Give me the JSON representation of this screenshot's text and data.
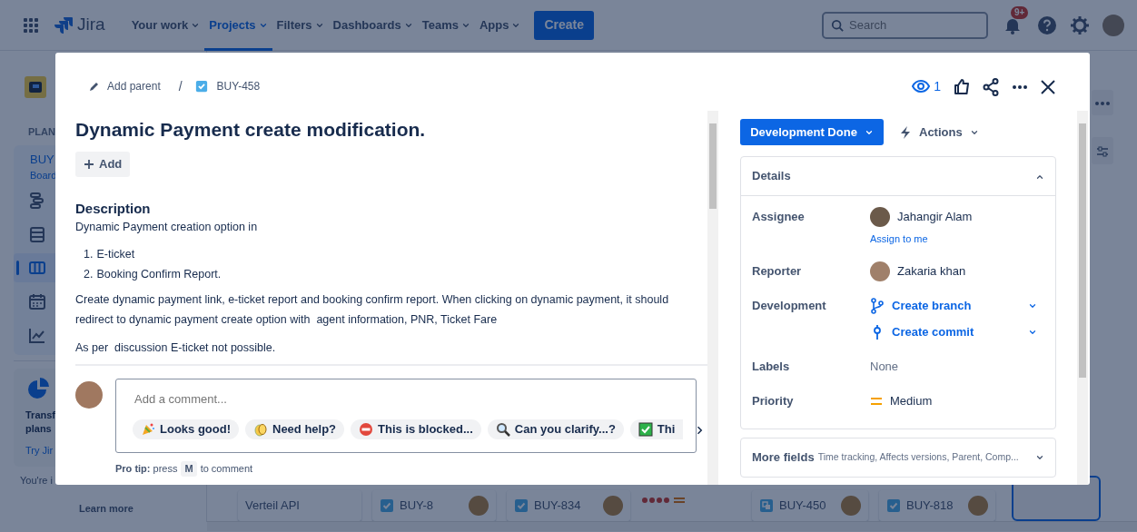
{
  "top_nav": {
    "product": "Jira",
    "menus": [
      {
        "label": "Your work",
        "selected": false
      },
      {
        "label": "Projects",
        "selected": true
      },
      {
        "label": "Filters",
        "selected": false
      },
      {
        "label": "Dashboards",
        "selected": false
      },
      {
        "label": "Teams",
        "selected": false
      },
      {
        "label": "Apps",
        "selected": false
      }
    ],
    "create_button": "Create",
    "search": {
      "placeholder": "Search"
    },
    "notification_count": "9+"
  },
  "sidebar": {
    "section_heading": "PLAN",
    "project_name": "BUY",
    "project_view": "Board",
    "items": [
      {
        "selected": false
      },
      {
        "selected": false
      },
      {
        "selected": true
      },
      {
        "selected": false
      },
      {
        "selected": false
      }
    ],
    "promo": {
      "title_lines": [
        "Transf",
        "plans"
      ],
      "link": "Try Jir"
    },
    "footer_text": "You're i",
    "learn_more": "Learn more"
  },
  "board": {
    "cards": [
      {
        "kind": "title",
        "text": "Verteil API"
      },
      {
        "kind": "task",
        "key": "BUY-8"
      },
      {
        "kind": "task",
        "key": "BUY-834"
      },
      {
        "kind": "estimate"
      },
      {
        "kind": "subtask",
        "key": "BUY-450"
      },
      {
        "kind": "task",
        "key": "BUY-818"
      }
    ]
  },
  "issue": {
    "parent_action": "Add parent",
    "separator": "/",
    "key": "BUY-458",
    "watchers": "1",
    "title": "Dynamic Payment create modification.",
    "add_button": "Add",
    "description": {
      "heading": "Description",
      "intro": "Dynamic Payment creation option in",
      "list": [
        {
          "number": "1.",
          "text": "E-ticket"
        },
        {
          "number": "2.",
          "text": "Booking Confirm Report."
        }
      ],
      "paragraphs": [
        "Create dynamic payment link, e-ticket report and booking confirm report. When clicking on dynamic payment, it should redirect to dynamic payment create option with  agent information, PNR, Ticket Fare",
        "As per  discussion E-ticket not possible."
      ]
    },
    "comment": {
      "placeholder": "Add a comment...",
      "quick_replies": [
        "Looks good!",
        "Need help?",
        "This is blocked...",
        "Can you clarify...?",
        "Thi"
      ],
      "pro_tip": {
        "lead": "**Pro tip:** press",
        "key": "M",
        "trail": "to comment"
      }
    }
  },
  "status": {
    "label": "Development Done"
  },
  "actions": "Actions",
  "details": {
    "heading": "Details",
    "expanded": true,
    "fields": [
      {
        "kind": "person",
        "label": "Assignee",
        "name": "Jahangir Alam",
        "link": "Assign to me"
      },
      {
        "kind": "person",
        "label": "Reporter",
        "name": "Zakaria khan"
      },
      {
        "kind": "development",
        "label": "Development",
        "links": [
          "Create branch",
          "Create commit"
        ]
      },
      {
        "kind": "text",
        "label": "Labels",
        "value": "None"
      },
      {
        "kind": "priority",
        "label": "Priority",
        "value": "Medium"
      }
    ]
  },
  "more_fields": {
    "label": "More fields",
    "summary": "Time tracking, Affects versions, Parent, Comp...",
    "expanded": false
  }
}
